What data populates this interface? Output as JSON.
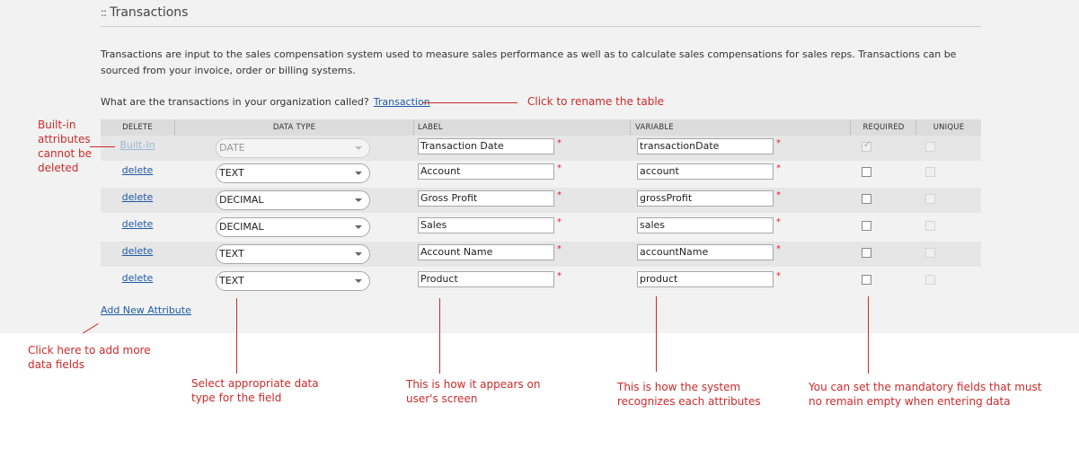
{
  "section": {
    "grip": "::",
    "title": "Transactions"
  },
  "description": "Transactions are input to the sales compensation system used to measure sales performance as well as to calculate sales compensations for sales reps. Transactions can be sourced from your invoice, order or billing systems.",
  "naming": {
    "question": "What are the transactions in your organization called?",
    "link": "Transaction"
  },
  "table": {
    "headers": {
      "delete": "DELETE",
      "data_type": "DATA TYPE",
      "label": "LABEL",
      "variable": "VARIABLE",
      "required": "REQUIRED",
      "unique": "UNIQUE"
    },
    "required_marker": "*",
    "rows": [
      {
        "delete": "Built-In",
        "data_type": "DATE",
        "label": "Transaction Date",
        "variable": "transactionDate",
        "required": true,
        "unique": false
      },
      {
        "delete": "delete",
        "data_type": "TEXT",
        "label": "Account",
        "variable": "account",
        "required": false,
        "unique": false
      },
      {
        "delete": "delete",
        "data_type": "DECIMAL",
        "label": "Gross Profit",
        "variable": "grossProfit",
        "required": false,
        "unique": false
      },
      {
        "delete": "delete",
        "data_type": "DECIMAL",
        "label": "Sales",
        "variable": "sales",
        "required": false,
        "unique": false
      },
      {
        "delete": "delete",
        "data_type": "TEXT",
        "label": "Account Name",
        "variable": "accountName",
        "required": false,
        "unique": false
      },
      {
        "delete": "delete",
        "data_type": "TEXT",
        "label": "Product",
        "variable": "product",
        "required": false,
        "unique": false
      }
    ]
  },
  "add_attribute": "Add New Attribute",
  "annotations": {
    "rename": "Click to rename the table",
    "builtin": "Built-in attributes cannot be deleted",
    "add_more": "Click here to add more data fields",
    "data_type": "Select appropriate data type for the field",
    "label": "This is how it appears on user's screen",
    "variable": "This is how the system recognizes each attributes",
    "mandatory": "You can set the mandatory fields that must no remain empty when entering data"
  },
  "colors": {
    "annotation": "#cc2a2a",
    "link": "#1f5aa6",
    "panel": "#f2f2f2"
  }
}
